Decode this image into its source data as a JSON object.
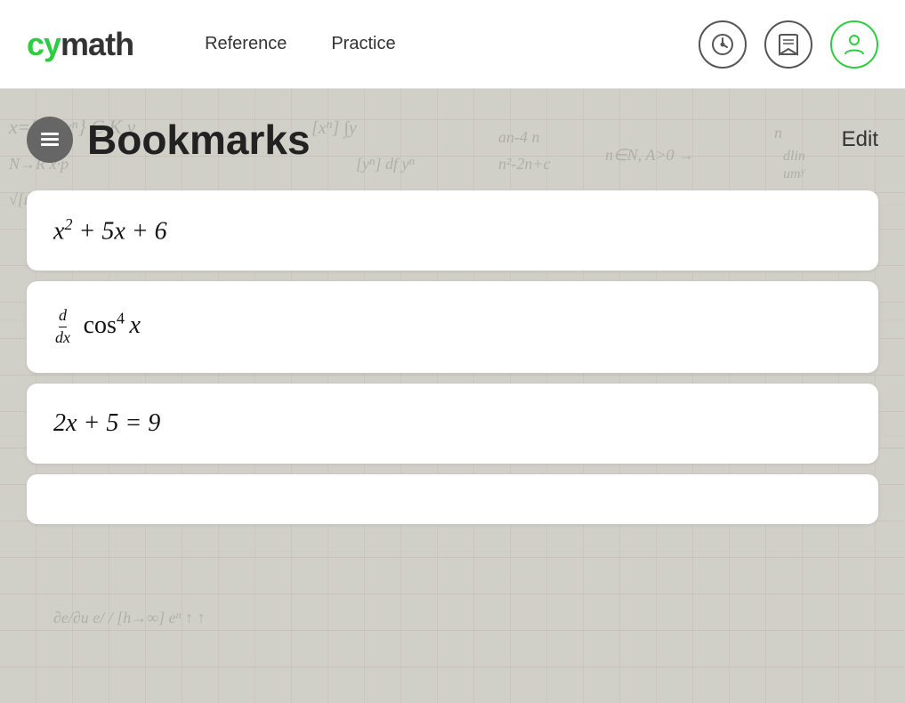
{
  "header": {
    "logo": {
      "part1": "cy",
      "part2": "math"
    },
    "nav": [
      {
        "label": "Reference",
        "id": "nav-reference"
      },
      {
        "label": "Practice",
        "id": "nav-practice"
      }
    ],
    "icons": [
      {
        "name": "history-icon",
        "title": "History"
      },
      {
        "name": "bookmarks-icon",
        "title": "Bookmarks"
      },
      {
        "name": "user-icon",
        "title": "User"
      }
    ]
  },
  "page": {
    "title": "Bookmarks",
    "edit_label": "Edit",
    "cards": [
      {
        "id": "card-1",
        "display": "x² + 5x + 6",
        "type": "text"
      },
      {
        "id": "card-2",
        "display": "d/dx cos⁴ x",
        "type": "text"
      },
      {
        "id": "card-3",
        "display": "2x + 5 = 9",
        "type": "text"
      }
    ]
  },
  "colors": {
    "accent_green": "#2ecc40",
    "nav_text": "#333333",
    "title_text": "#222222",
    "card_bg": "#ffffff"
  }
}
